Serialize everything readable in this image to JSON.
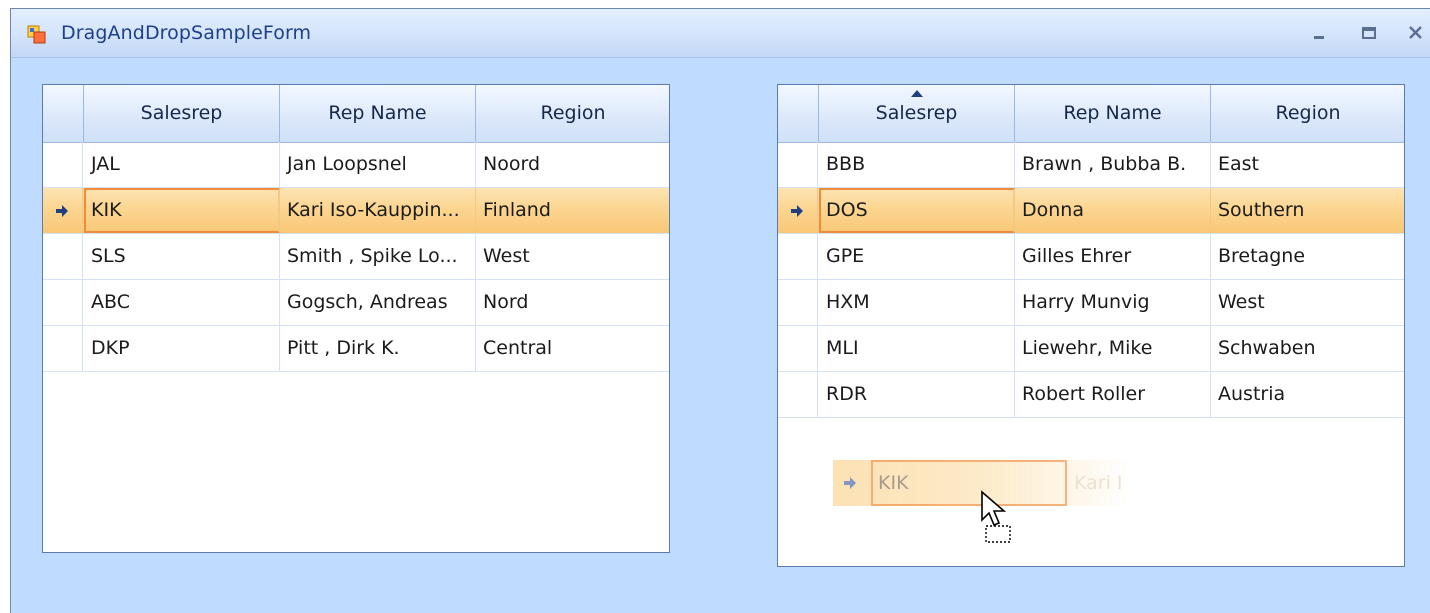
{
  "window": {
    "title": "DragAndDropSampleForm",
    "controls": [
      "minimize",
      "maximize",
      "close"
    ]
  },
  "left_grid": {
    "columns": [
      "Salesrep",
      "Rep Name",
      "Region"
    ],
    "rows": [
      {
        "salesrep": "JAL",
        "rep_name": "Jan Loopsnel",
        "region": "Noord"
      },
      {
        "salesrep": "KIK",
        "rep_name": "Kari Iso-Kauppin...",
        "region": "Finland"
      },
      {
        "salesrep": "SLS",
        "rep_name": "Smith , Spike Lo...",
        "region": "West"
      },
      {
        "salesrep": "ABC",
        "rep_name": "Gogsch, Andreas",
        "region": "Nord"
      },
      {
        "salesrep": "DKP",
        "rep_name": "Pitt , Dirk K.",
        "region": "Central"
      }
    ],
    "selected_row": 1
  },
  "right_grid": {
    "columns": [
      "Salesrep",
      "Rep Name",
      "Region"
    ],
    "sorted_column": "Salesrep",
    "sort_direction": "ascending",
    "rows": [
      {
        "salesrep": "BBB",
        "rep_name": "Brawn , Bubba B.",
        "region": "East"
      },
      {
        "salesrep": "DOS",
        "rep_name": "Donna",
        "region": "Southern"
      },
      {
        "salesrep": "GPE",
        "rep_name": "Gilles Ehrer",
        "region": "Bretagne"
      },
      {
        "salesrep": "HXM",
        "rep_name": "Harry Munvig",
        "region": "West"
      },
      {
        "salesrep": "MLI",
        "rep_name": "Liewehr, Mike",
        "region": "Schwaben"
      },
      {
        "salesrep": "RDR",
        "rep_name": "Robert Roller",
        "region": "Austria"
      }
    ],
    "selected_row": 1
  },
  "drag_preview": {
    "salesrep": "KIK",
    "rep_name": "Kari I"
  },
  "colors": {
    "window_bg": "#bfdbff",
    "selection": "#fbd48e",
    "focus_border": "#f08b3a",
    "header_text": "#15294a",
    "title_text": "#1e3f8a"
  },
  "icons": {
    "app": "app-icon",
    "row_indicator": "row-arrow-icon",
    "sort": "sort-ascending-icon",
    "cursor": "drag-copy-cursor-icon"
  }
}
